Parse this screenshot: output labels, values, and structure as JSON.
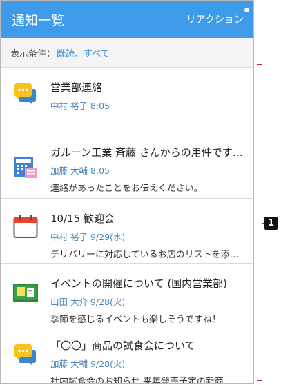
{
  "header": {
    "title": "通知一覧",
    "reaction_label": "リアクション"
  },
  "filter": {
    "label": "表示条件：",
    "value": "既読、すべて"
  },
  "items": [
    {
      "icon": "chat-bubbles-icon",
      "title": "営業部連絡",
      "meta": "中村 裕子 8:05",
      "body": ""
    },
    {
      "icon": "phone-memo-icon",
      "title": "ガルーン工業 斉藤 さんからの用件です…",
      "meta": "加藤 大輔 8:05",
      "body": "連絡があったことをお伝えください。"
    },
    {
      "icon": "calendar-icon",
      "title": "10/15 歓迎会",
      "meta": "中村 裕子 9/29(水)",
      "body": "デリバリーに対応しているお店のリストを添…"
    },
    {
      "icon": "bulletin-board-icon",
      "title": "イベントの開催について (国内営業部)",
      "meta": "山田 大介 9/28(火)",
      "body": "季節を感じるイベントも楽しそうですね！"
    },
    {
      "icon": "chat-bubbles-icon",
      "title": "「〇〇」商品の試食会について",
      "meta": "加藤 大輔 9/28(火)",
      "body": "社内試食会のお知らせ 来年発売予定の新商…"
    }
  ],
  "callout": {
    "number": "1"
  },
  "colors": {
    "header": "#3d9be9",
    "link": "#3d8fd9",
    "meta": "#4e84b5",
    "callout": "#d81a1a"
  }
}
